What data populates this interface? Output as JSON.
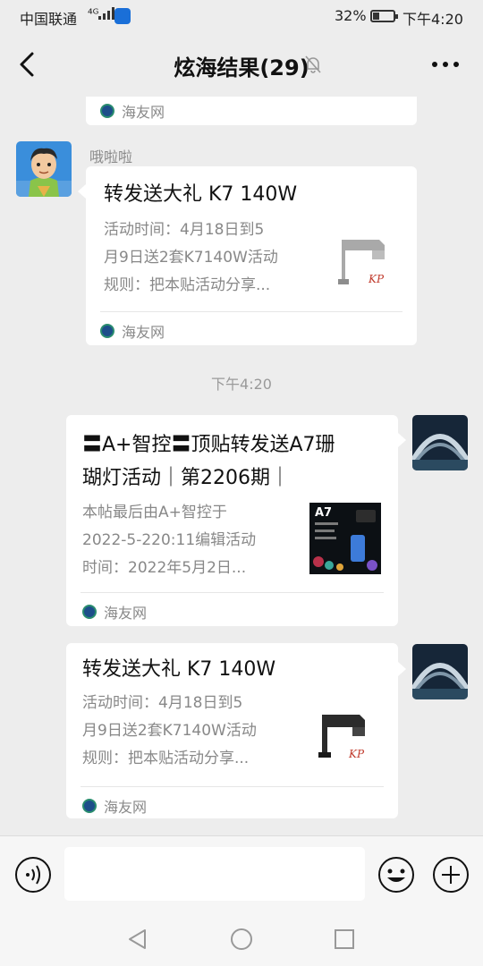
{
  "status_bar": {
    "carrier": "中国联通",
    "network": "⁴ᴳ",
    "battery_percent": "32%",
    "battery_level": 0.32,
    "time": "下午4:20"
  },
  "header": {
    "title": "炫海结果(29)"
  },
  "messages": [
    {
      "source": "海友网"
    },
    {
      "sender": "哦啦啦",
      "title": "转发送大礼 K7 140W",
      "desc_lines": [
        "活动时间：4月18日到5",
        "月9日送2套K7140W活动",
        "规则：把本贴活动分享..."
      ],
      "source": "海友网"
    },
    {
      "timestamp": "下午4:20"
    },
    {
      "title_lines": [
        "〓A+智控〓顶贴转发送A7珊",
        "瑚灯活动｜第2206期｜"
      ],
      "desc_lines": [
        "本帖最后由A+智控于",
        "2022-5-220:11编辑活动",
        "时间：2022年5月2日..."
      ],
      "thumb_label": "A7",
      "source": "海友网"
    },
    {
      "title": "转发送大礼 K7 140W",
      "desc_lines": [
        "活动时间：4月18日到5",
        "月9日送2套K7140W活动",
        "规则：把本贴活动分享..."
      ],
      "source": "海友网"
    }
  ],
  "input": {
    "placeholder": ""
  },
  "colors": {
    "background": "#ededed",
    "card": "#ffffff",
    "muted_text": "#888888"
  }
}
